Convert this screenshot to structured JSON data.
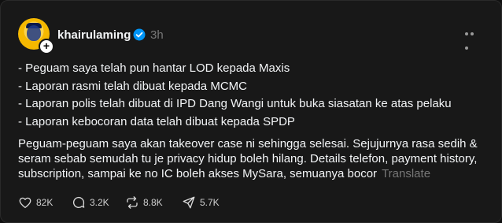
{
  "post": {
    "author": {
      "username": "khairulaming",
      "verified": true,
      "time_ago": "3h"
    },
    "bullets": [
      "- Peguam saya telah pun hantar LOD kepada Maxis",
      "- Laporan rasmi telah dibuat kepada MCMC",
      "- Laporan polis telah dibuat di IPD Dang Wangi untuk buka siasatan ke atas pelaku",
      "- Laporan kebocoran data telah dibuat kepada SPDP"
    ],
    "body": "Peguam-peguam saya akan takeover case ni sehingga selesai. Sejujurnya rasa sedih & seram sebab semudah tu je privacy hidup boleh hilang. Details telefon, payment history, subscription, sampai ke no IC boleh akses MySara, semuanya bocor",
    "translate_label": "Translate",
    "stats": {
      "likes": "82K",
      "comments": "3.2K",
      "reposts": "8.8K",
      "shares": "5.7K"
    }
  },
  "icons": {
    "avatar": "profile-avatar",
    "follow": "plus-icon",
    "verified": "verified-badge-icon",
    "more": "more-options-icon",
    "like": "heart-icon",
    "comment": "comment-icon",
    "repost": "repost-icon",
    "share": "share-icon"
  },
  "colors": {
    "background": "#181818",
    "text": "#f3f5f7",
    "muted": "#777777",
    "verified": "#0095f6"
  }
}
